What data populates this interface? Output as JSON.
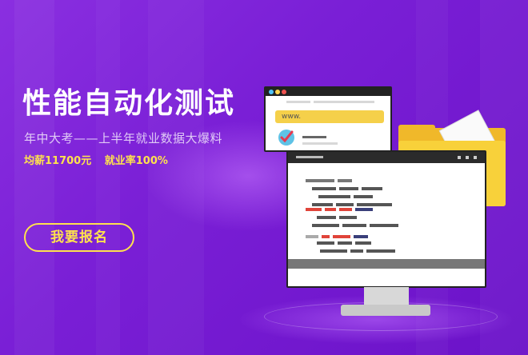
{
  "banner": {
    "title": "性能自动化测试",
    "subtitle": "年中大考——上半年就业数据大爆料",
    "stats": [
      "均薪11700元",
      "就业率100%"
    ],
    "cta_label": "我要报名",
    "browser_url": "www."
  },
  "colors": {
    "background": "#7a1fd6",
    "accent_yellow": "#ffe24d",
    "folder": "#f8d13a",
    "code_red": "#e0443a",
    "code_navy": "#3a3f7a",
    "code_gray": "#555555"
  },
  "icons": {
    "browser_check": "check-icon",
    "folder": "folder-icon",
    "monitor": "monitor-icon"
  }
}
